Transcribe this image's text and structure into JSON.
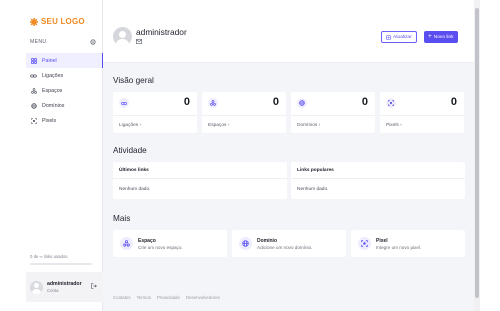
{
  "brand": {
    "logo_text": "SEU LOGO",
    "color": "#f08a24"
  },
  "sidebar": {
    "menu_label": "MENU",
    "items": [
      {
        "label": "Painel",
        "icon": "grid-icon",
        "active": true
      },
      {
        "label": "Ligações",
        "icon": "link-icon",
        "active": false
      },
      {
        "label": "Espaços",
        "icon": "spaces-icon",
        "active": false
      },
      {
        "label": "Domínios",
        "icon": "globe-icon",
        "active": false
      },
      {
        "label": "Pixels",
        "icon": "pixel-icon",
        "active": false
      }
    ],
    "usage_text": "0 de ∞ links usados.",
    "usage_fraction": 0.0,
    "user": {
      "name": "administrador",
      "role": "Conta"
    }
  },
  "header": {
    "title": "administrador",
    "refresh_label": "Atualizar",
    "new_link_label": "Novo link"
  },
  "overview": {
    "title": "Visão geral",
    "cards": [
      {
        "label": "Ligações",
        "value": "0",
        "icon": "link-icon"
      },
      {
        "label": "Espaços",
        "value": "0",
        "icon": "spaces-icon"
      },
      {
        "label": "Domínios",
        "value": "0",
        "icon": "globe-icon"
      },
      {
        "label": "Pixels",
        "value": "0",
        "icon": "pixel-icon"
      }
    ]
  },
  "activity": {
    "title": "Atividade",
    "panels": [
      {
        "title": "Últimos links",
        "empty": "Nenhum dado."
      },
      {
        "title": "Links populares",
        "empty": "Nenhum dado."
      }
    ]
  },
  "more": {
    "title": "Mais",
    "cards": [
      {
        "title": "Espaço",
        "desc": "Crie um novo espaço.",
        "icon": "spaces-icon"
      },
      {
        "title": "Domínio",
        "desc": "Adicione um novo domínio.",
        "icon": "globe-icon"
      },
      {
        "title": "Pixel",
        "desc": "Integre um novo pixel.",
        "icon": "pixel-icon"
      }
    ]
  },
  "footer": {
    "links": [
      "Contatos",
      "Termos",
      "Privacidade",
      "Desenvolvedores"
    ]
  },
  "colors": {
    "accent": "#5b4ef0",
    "accent_soft": "#eeecff",
    "background": "#f4f5f8"
  }
}
